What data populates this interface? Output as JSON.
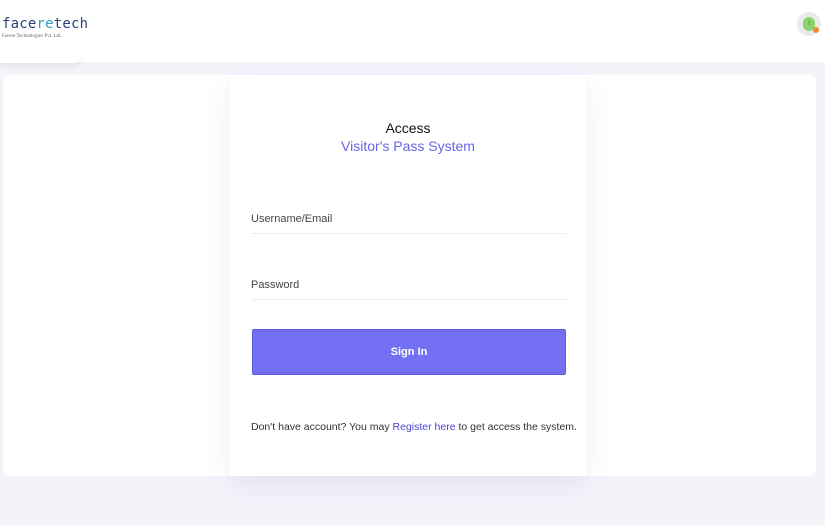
{
  "header": {
    "logo": {
      "part_face": "face",
      "part_re": "re",
      "part_tech": "tech",
      "subtitle": "Facere Technologies Pvt. Ltd."
    },
    "status_badge_text": "!"
  },
  "login": {
    "title": "Access",
    "subtitle": "Visitor's Pass System",
    "username_placeholder": "Username/Email",
    "password_placeholder": "Password",
    "signin_label": "Sign In",
    "register_prefix": "Don't have account? You may ",
    "register_link": "Register here",
    "register_suffix": " to get access the system."
  },
  "colors": {
    "accent": "#7370f4",
    "link": "#4b44d6",
    "subtitle": "#6c63e6",
    "background": "#f4f3fa"
  }
}
